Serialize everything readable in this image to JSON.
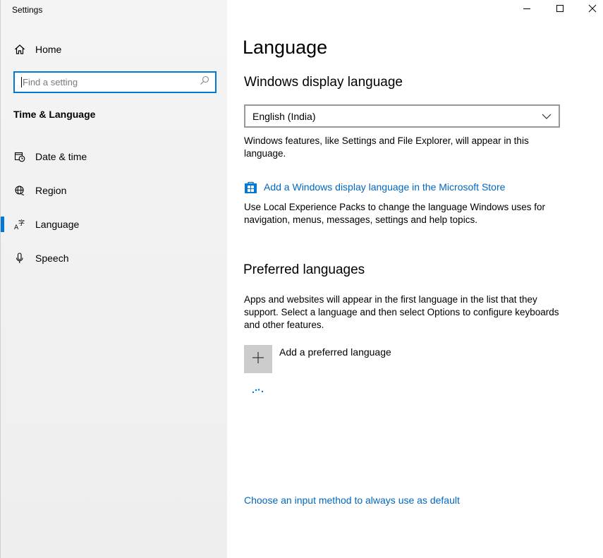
{
  "app": {
    "title": "Settings"
  },
  "sidebar": {
    "home_label": "Home",
    "search": {
      "placeholder": "Find a setting",
      "value": ""
    },
    "section_title": "Time & Language",
    "items": [
      {
        "label": "Date & time",
        "icon": "calendar-clock-icon",
        "selected": false
      },
      {
        "label": "Region",
        "icon": "globe-icon",
        "selected": false
      },
      {
        "label": "Language",
        "icon": "language-icon",
        "selected": true
      },
      {
        "label": "Speech",
        "icon": "microphone-icon",
        "selected": false
      }
    ]
  },
  "window_controls": {
    "minimize": "minimize-icon",
    "maximize": "maximize-icon",
    "close": "close-icon"
  },
  "main": {
    "title": "Language",
    "display_language": {
      "heading": "Windows display language",
      "selected": "English (India)",
      "description": "Windows features, like Settings and File Explorer, will appear in this language.",
      "store_link": "Add a Windows display language in the Microsoft Store",
      "store_description": "Use Local Experience Packs to change the language Windows uses for navigation, menus, messages, settings and help topics."
    },
    "preferred": {
      "heading": "Preferred languages",
      "description": "Apps and websites will appear in the first language in the list that they support. Select a language and then select Options to configure keyboards and other features.",
      "add_label": "Add a preferred language"
    },
    "input_method_link": "Choose an input method to always use as default"
  },
  "colors": {
    "accent": "#0078d7",
    "link": "#0067c0",
    "sidebar_bg": "#f2f2f2",
    "add_button_bg": "#cccccc"
  }
}
